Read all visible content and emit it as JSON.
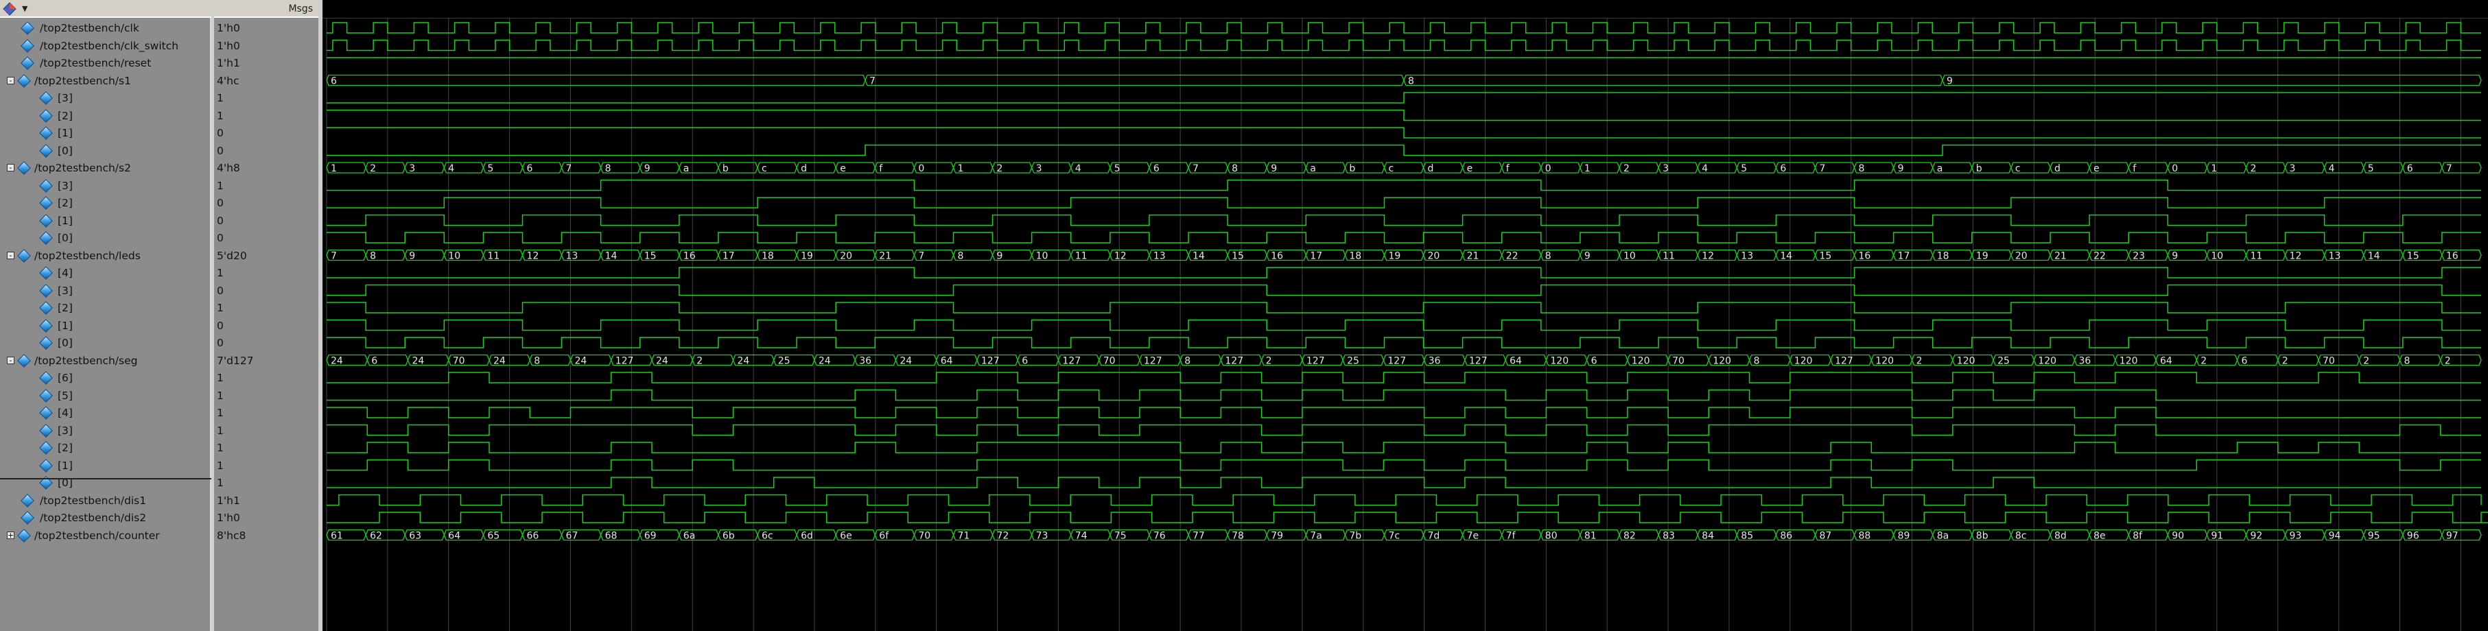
{
  "header": {
    "msgs_label": "Msgs"
  },
  "colors": {
    "wave": "#19d219",
    "grid": "#444444",
    "background": "#000000",
    "pane": "#8c8c8c"
  },
  "rows": [
    {
      "name": "/top2testbench/clk",
      "value": "1'h0",
      "indent": 1,
      "expander": "",
      "kind": "clock",
      "clock": "clk"
    },
    {
      "name": "/top2testbench/clk_switch",
      "value": "1'h0",
      "indent": 1,
      "expander": "",
      "kind": "clock",
      "clock": "clk"
    },
    {
      "name": "/top2testbench/reset",
      "value": "1'h1",
      "indent": 1,
      "expander": "",
      "kind": "level",
      "level": 1
    },
    {
      "name": "/top2testbench/s1",
      "value": "4'hc",
      "indent": 0,
      "expander": "-",
      "kind": "bus",
      "bus": "s1"
    },
    {
      "name": "[3]",
      "value": "1",
      "indent": 2,
      "expander": "",
      "kind": "bit",
      "bus": "s1",
      "bit": 3
    },
    {
      "name": "[2]",
      "value": "1",
      "indent": 2,
      "expander": "",
      "kind": "bit",
      "bus": "s1",
      "bit": 2
    },
    {
      "name": "[1]",
      "value": "0",
      "indent": 2,
      "expander": "",
      "kind": "bit",
      "bus": "s1",
      "bit": 1
    },
    {
      "name": "[0]",
      "value": "0",
      "indent": 2,
      "expander": "",
      "kind": "bit",
      "bus": "s1",
      "bit": 0
    },
    {
      "name": "/top2testbench/s2",
      "value": "4'h8",
      "indent": 0,
      "expander": "-",
      "kind": "bus",
      "bus": "s2"
    },
    {
      "name": "[3]",
      "value": "1",
      "indent": 2,
      "expander": "",
      "kind": "bit",
      "bus": "s2",
      "bit": 3
    },
    {
      "name": "[2]",
      "value": "0",
      "indent": 2,
      "expander": "",
      "kind": "bit",
      "bus": "s2",
      "bit": 2
    },
    {
      "name": "[1]",
      "value": "0",
      "indent": 2,
      "expander": "",
      "kind": "bit",
      "bus": "s2",
      "bit": 1
    },
    {
      "name": "[0]",
      "value": "0",
      "indent": 2,
      "expander": "",
      "kind": "bit",
      "bus": "s2",
      "bit": 0
    },
    {
      "name": "/top2testbench/leds",
      "value": "5'd20",
      "indent": 0,
      "expander": "-",
      "kind": "bus",
      "bus": "leds"
    },
    {
      "name": "[4]",
      "value": "1",
      "indent": 2,
      "expander": "",
      "kind": "bit",
      "bus": "leds",
      "bit": 4
    },
    {
      "name": "[3]",
      "value": "0",
      "indent": 2,
      "expander": "",
      "kind": "bit",
      "bus": "leds",
      "bit": 3
    },
    {
      "name": "[2]",
      "value": "1",
      "indent": 2,
      "expander": "",
      "kind": "bit",
      "bus": "leds",
      "bit": 2
    },
    {
      "name": "[1]",
      "value": "0",
      "indent": 2,
      "expander": "",
      "kind": "bit",
      "bus": "leds",
      "bit": 1
    },
    {
      "name": "[0]",
      "value": "0",
      "indent": 2,
      "expander": "",
      "kind": "bit",
      "bus": "leds",
      "bit": 0
    },
    {
      "name": "/top2testbench/seg",
      "value": "7'd127",
      "indent": 0,
      "expander": "-",
      "kind": "bus",
      "bus": "seg"
    },
    {
      "name": "[6]",
      "value": "1",
      "indent": 2,
      "expander": "",
      "kind": "bit",
      "bus": "seg",
      "bit": 6
    },
    {
      "name": "[5]",
      "value": "1",
      "indent": 2,
      "expander": "",
      "kind": "bit",
      "bus": "seg",
      "bit": 5
    },
    {
      "name": "[4]",
      "value": "1",
      "indent": 2,
      "expander": "",
      "kind": "bit",
      "bus": "seg",
      "bit": 4
    },
    {
      "name": "[3]",
      "value": "1",
      "indent": 2,
      "expander": "",
      "kind": "bit",
      "bus": "seg",
      "bit": 3
    },
    {
      "name": "[2]",
      "value": "1",
      "indent": 2,
      "expander": "",
      "kind": "bit",
      "bus": "seg",
      "bit": 2
    },
    {
      "name": "[1]",
      "value": "1",
      "indent": 2,
      "expander": "",
      "kind": "bit",
      "bus": "seg",
      "bit": 1
    },
    {
      "name": "[0]",
      "value": "1",
      "indent": 2,
      "expander": "",
      "kind": "bit",
      "bus": "seg",
      "bit": 0
    },
    {
      "name": "/top2testbench/dis1",
      "value": "1'h1",
      "indent": 1,
      "expander": "",
      "kind": "clock",
      "clock": "dis"
    },
    {
      "name": "/top2testbench/dis2",
      "value": "1'h0",
      "indent": 1,
      "expander": "",
      "kind": "clock",
      "clock": "dis2"
    },
    {
      "name": "/top2testbench/counter",
      "value": "8'hc8",
      "indent": 0,
      "expander": "+",
      "kind": "bus",
      "bus": "counter"
    }
  ],
  "buses": {
    "s1": {
      "radix": "hex",
      "values": [
        6,
        7,
        8,
        9
      ]
    },
    "s2": {
      "radix": "hex",
      "values": [
        1,
        2,
        3,
        4,
        5,
        6,
        7,
        8,
        9,
        10,
        11,
        12,
        13,
        14,
        15,
        0,
        1,
        2,
        3,
        4,
        5,
        6,
        7,
        8,
        9,
        10,
        11,
        12,
        13,
        14,
        15,
        0,
        1,
        2,
        3,
        4,
        5,
        6,
        7,
        8,
        9,
        10,
        11,
        12,
        13,
        14,
        15,
        0,
        1,
        2,
        3,
        4,
        5,
        6,
        7
      ]
    },
    "leds": {
      "radix": "dec",
      "values": [
        7,
        8,
        9,
        10,
        11,
        12,
        13,
        14,
        15,
        16,
        17,
        18,
        19,
        20,
        21,
        7,
        8,
        9,
        10,
        11,
        12,
        13,
        14,
        15,
        16,
        17,
        18,
        19,
        20,
        21,
        22,
        8,
        9,
        10,
        11,
        12,
        13,
        14,
        15,
        16,
        17,
        18,
        19,
        20,
        21,
        22,
        23,
        9,
        10,
        11,
        12,
        13,
        14,
        15,
        16
      ]
    },
    "seg": {
      "radix": "dec",
      "values": [
        24,
        6,
        24,
        70,
        24,
        8,
        24,
        127,
        24,
        2,
        24,
        25,
        24,
        36,
        24,
        64,
        127,
        6,
        127,
        70,
        127,
        8,
        127,
        2,
        127,
        25,
        127,
        36,
        127,
        64,
        120,
        6,
        120,
        70,
        120,
        8,
        120,
        127,
        120,
        2,
        120,
        25,
        120,
        36,
        120,
        64,
        2,
        6,
        2,
        70,
        2,
        8,
        2
      ]
    },
    "counter": {
      "radix": "hex",
      "values": [
        97,
        98,
        99,
        100,
        101,
        102,
        103,
        104,
        105,
        106,
        107,
        108,
        109,
        110,
        111,
        112,
        113,
        114,
        115,
        116,
        117,
        118,
        119,
        120,
        121,
        122,
        123,
        124,
        125,
        126,
        127,
        128,
        129,
        130,
        131,
        132,
        133,
        134,
        135,
        136,
        137,
        138,
        139,
        140,
        141,
        142,
        143,
        144,
        145,
        146,
        147,
        148,
        149,
        150,
        151
      ]
    }
  }
}
